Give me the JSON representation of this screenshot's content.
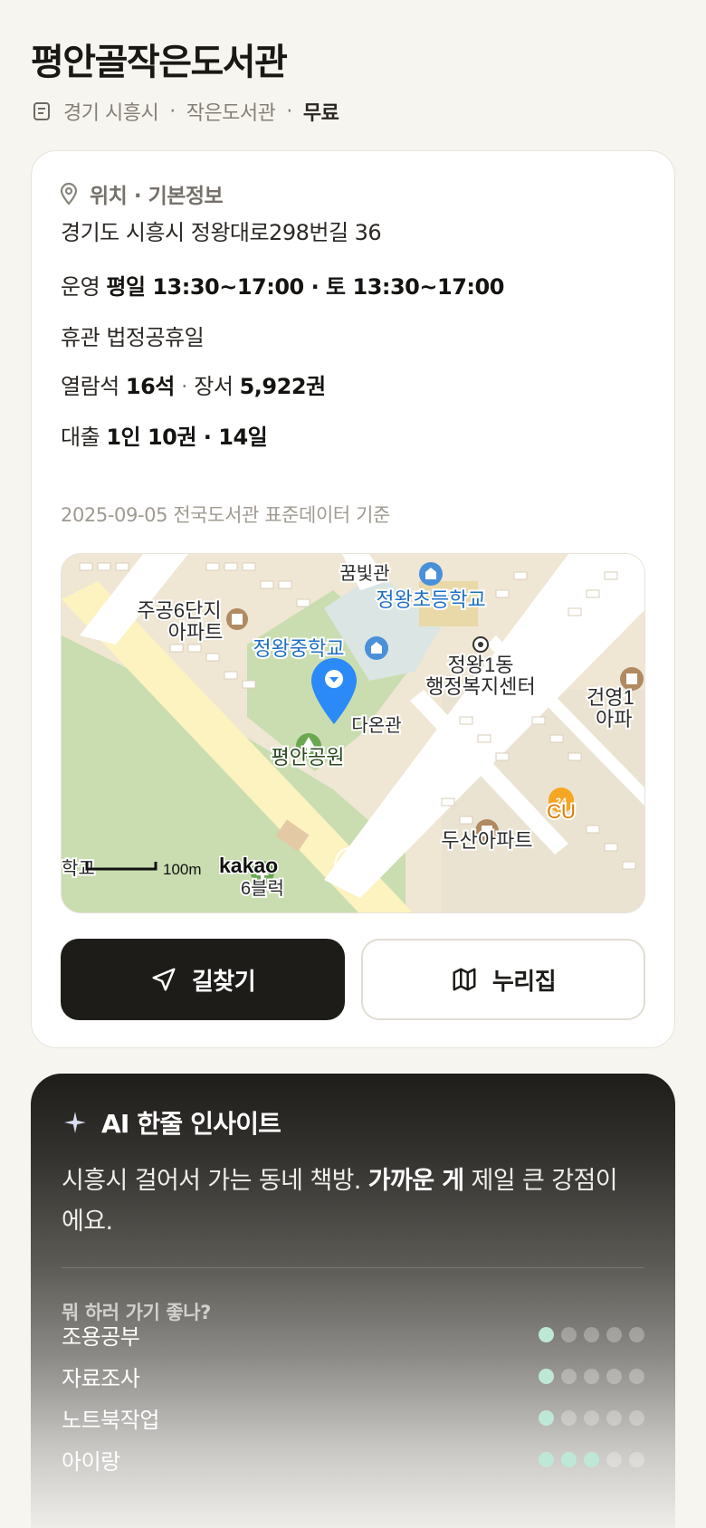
{
  "header": {
    "title": "평안골작은도서관",
    "region": "경기 시흥시",
    "sep1": "·",
    "type": "작은도서관",
    "sep2": "·",
    "fee": "무료"
  },
  "info": {
    "section_title": "위치 · 기본정보",
    "address": "경기도 시흥시 정왕대로298번길 36",
    "hours_label": "운영",
    "hours_value": "평일 13:30~17:00 · 토 13:30~17:00",
    "closed_label": "휴관",
    "closed_value": "법정공휴일",
    "seats_label": "열람석",
    "seats_value": "16석",
    "books_sep": "·",
    "books_label": "장서",
    "books_value": "5,922권",
    "loan_label": "대출",
    "loan_value": "1인 10권 · 14일",
    "data_source": "2025-09-05 전국도서관 표준데이터 기준"
  },
  "map": {
    "labels": {
      "dream": "꿈빛관",
      "elementary": "정왕초등학교",
      "apt6_line1": "주공6단지",
      "apt6_line2": "아파트",
      "middle": "정왕중학교",
      "center_line1": "정왕1동",
      "center_line2": "행정복지센터",
      "geonyoung_line1": "건영1",
      "geonyoung_line2": "아파",
      "daon": "다온관",
      "park": "평안공원",
      "cu": "CU",
      "doosan": "두산아파트",
      "school_cut": "학교",
      "block_cut": "6블럭",
      "scale": "100m",
      "brand": "kakao"
    },
    "colors": {
      "pin": "#2b8af7",
      "road": "#fdf5c4",
      "park": "#c7dcab",
      "school": "#dbe6e6",
      "label_blue": "#1f6fc4"
    }
  },
  "buttons": {
    "directions": "길찾기",
    "nurijip": "누리집"
  },
  "ai": {
    "title": "AI 한줄 인사이트",
    "text_part1": "시흥시 걸어서 가는 동네 책방.",
    "text_bold": "가까운 게",
    "text_part2": "제일 큰 강점이에요.",
    "question": "뭐 하러 가기 좋나?",
    "ratings": [
      {
        "label": "조용공부",
        "score": 1,
        "max": 5
      },
      {
        "label": "자료조사",
        "score": 1,
        "max": 5
      },
      {
        "label": "노트북작업",
        "score": 1,
        "max": 5
      },
      {
        "label": "아이랑",
        "score": 3,
        "max": 5
      }
    ],
    "accent": "#bfe7d7"
  }
}
